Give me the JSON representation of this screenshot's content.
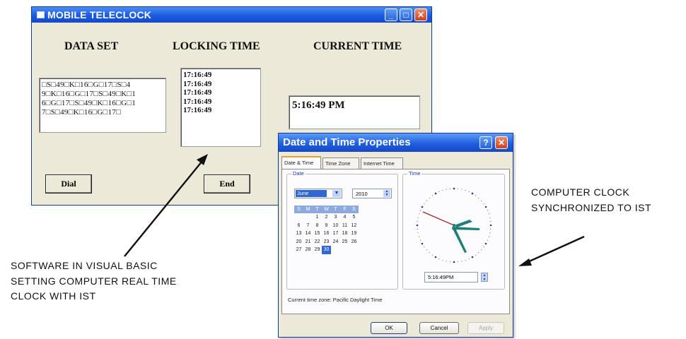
{
  "teleclock": {
    "title": "MOBILE TELECLOCK",
    "data_set_label": "DATA SET",
    "locking_time_label": "LOCKING TIME",
    "current_time_label": "CURRENT TIME",
    "data_set_lines": [
      "□S□49□K□16□G□17□S□4",
      "9□K□16□G□17□S□49□K□1",
      "6□G□17□S□49□K□16□G□1",
      "7□S□49□K□16□G□17□"
    ],
    "locking_times": [
      "17:16:49",
      "17:16:49",
      "17:16:49",
      "17:16:49",
      "17:16:49"
    ],
    "current_time": "5:16:49 PM",
    "dial_button": "Dial",
    "end_button": "End"
  },
  "datetime_dialog": {
    "title": "Date and Time Properties",
    "tabs": [
      "Date & Time",
      "Time Zone",
      "Internet Time"
    ],
    "date_group_label": "Date",
    "time_group_label": "Time",
    "month": "June",
    "year": "2010",
    "weekdays": [
      "S",
      "M",
      "T",
      "W",
      "T",
      "F",
      "S"
    ],
    "calendar_rows": [
      [
        "",
        "",
        "1",
        "2",
        "3",
        "4",
        "5"
      ],
      [
        "6",
        "7",
        "8",
        "9",
        "10",
        "11",
        "12"
      ],
      [
        "13",
        "14",
        "15",
        "16",
        "17",
        "18",
        "19"
      ],
      [
        "20",
        "21",
        "22",
        "23",
        "24",
        "25",
        "26"
      ],
      [
        "27",
        "28",
        "29",
        "30",
        "",
        "",
        ""
      ]
    ],
    "selected_day": "30",
    "time_value": "5:16:49PM",
    "timezone_text": "Current time zone:  Pacific Daylight Time",
    "ok_button": "OK",
    "cancel_button": "Cancel",
    "apply_button": "Apply"
  },
  "annotations": {
    "left_lines": [
      "SOFTWARE IN VISUAL BASIC",
      "SETTING COMPUTER REAL TIME",
      "CLOCK WITH IST"
    ],
    "right_lines": [
      "COMPUTER CLOCK",
      "SYNCHRONIZED TO IST"
    ]
  },
  "colors": {
    "titlebar": "#1c5ce0",
    "window_bg": "#ece9d8",
    "calendar_header": "#8ea9e0",
    "selection": "#3167d4",
    "clock_hand": "#1d7f78",
    "clock_second_hand": "#b02020"
  }
}
